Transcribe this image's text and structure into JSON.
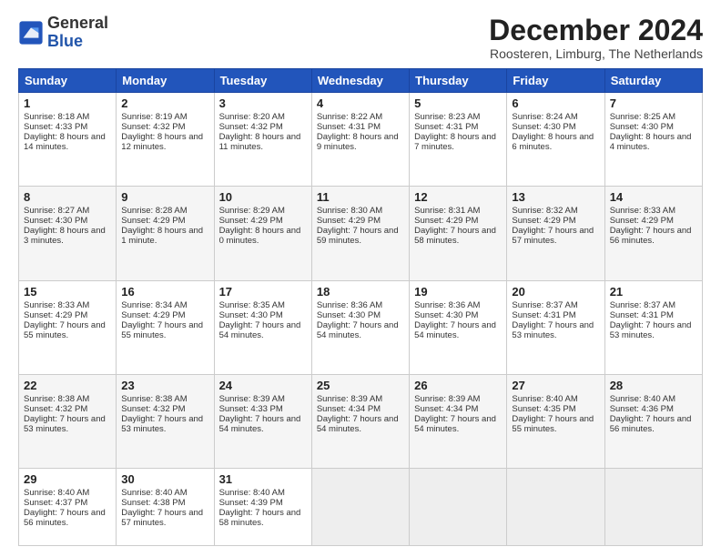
{
  "logo": {
    "general": "General",
    "blue": "Blue"
  },
  "title": "December 2024",
  "subtitle": "Roosteren, Limburg, The Netherlands",
  "weekdays": [
    "Sunday",
    "Monday",
    "Tuesday",
    "Wednesday",
    "Thursday",
    "Friday",
    "Saturday"
  ],
  "weeks": [
    [
      {
        "num": "1",
        "sunrise": "8:18 AM",
        "sunset": "4:33 PM",
        "daylight": "8 hours and 14 minutes"
      },
      {
        "num": "2",
        "sunrise": "8:19 AM",
        "sunset": "4:32 PM",
        "daylight": "8 hours and 12 minutes"
      },
      {
        "num": "3",
        "sunrise": "8:20 AM",
        "sunset": "4:32 PM",
        "daylight": "8 hours and 11 minutes"
      },
      {
        "num": "4",
        "sunrise": "8:22 AM",
        "sunset": "4:31 PM",
        "daylight": "8 hours and 9 minutes"
      },
      {
        "num": "5",
        "sunrise": "8:23 AM",
        "sunset": "4:31 PM",
        "daylight": "8 hours and 7 minutes"
      },
      {
        "num": "6",
        "sunrise": "8:24 AM",
        "sunset": "4:30 PM",
        "daylight": "8 hours and 6 minutes"
      },
      {
        "num": "7",
        "sunrise": "8:25 AM",
        "sunset": "4:30 PM",
        "daylight": "8 hours and 4 minutes"
      }
    ],
    [
      {
        "num": "8",
        "sunrise": "8:27 AM",
        "sunset": "4:30 PM",
        "daylight": "8 hours and 3 minutes"
      },
      {
        "num": "9",
        "sunrise": "8:28 AM",
        "sunset": "4:29 PM",
        "daylight": "8 hours and 1 minute"
      },
      {
        "num": "10",
        "sunrise": "8:29 AM",
        "sunset": "4:29 PM",
        "daylight": "8 hours and 0 minutes"
      },
      {
        "num": "11",
        "sunrise": "8:30 AM",
        "sunset": "4:29 PM",
        "daylight": "7 hours and 59 minutes"
      },
      {
        "num": "12",
        "sunrise": "8:31 AM",
        "sunset": "4:29 PM",
        "daylight": "7 hours and 58 minutes"
      },
      {
        "num": "13",
        "sunrise": "8:32 AM",
        "sunset": "4:29 PM",
        "daylight": "7 hours and 57 minutes"
      },
      {
        "num": "14",
        "sunrise": "8:33 AM",
        "sunset": "4:29 PM",
        "daylight": "7 hours and 56 minutes"
      }
    ],
    [
      {
        "num": "15",
        "sunrise": "8:33 AM",
        "sunset": "4:29 PM",
        "daylight": "7 hours and 55 minutes"
      },
      {
        "num": "16",
        "sunrise": "8:34 AM",
        "sunset": "4:29 PM",
        "daylight": "7 hours and 55 minutes"
      },
      {
        "num": "17",
        "sunrise": "8:35 AM",
        "sunset": "4:30 PM",
        "daylight": "7 hours and 54 minutes"
      },
      {
        "num": "18",
        "sunrise": "8:36 AM",
        "sunset": "4:30 PM",
        "daylight": "7 hours and 54 minutes"
      },
      {
        "num": "19",
        "sunrise": "8:36 AM",
        "sunset": "4:30 PM",
        "daylight": "7 hours and 54 minutes"
      },
      {
        "num": "20",
        "sunrise": "8:37 AM",
        "sunset": "4:31 PM",
        "daylight": "7 hours and 53 minutes"
      },
      {
        "num": "21",
        "sunrise": "8:37 AM",
        "sunset": "4:31 PM",
        "daylight": "7 hours and 53 minutes"
      }
    ],
    [
      {
        "num": "22",
        "sunrise": "8:38 AM",
        "sunset": "4:32 PM",
        "daylight": "7 hours and 53 minutes"
      },
      {
        "num": "23",
        "sunrise": "8:38 AM",
        "sunset": "4:32 PM",
        "daylight": "7 hours and 53 minutes"
      },
      {
        "num": "24",
        "sunrise": "8:39 AM",
        "sunset": "4:33 PM",
        "daylight": "7 hours and 54 minutes"
      },
      {
        "num": "25",
        "sunrise": "8:39 AM",
        "sunset": "4:34 PM",
        "daylight": "7 hours and 54 minutes"
      },
      {
        "num": "26",
        "sunrise": "8:39 AM",
        "sunset": "4:34 PM",
        "daylight": "7 hours and 54 minutes"
      },
      {
        "num": "27",
        "sunrise": "8:40 AM",
        "sunset": "4:35 PM",
        "daylight": "7 hours and 55 minutes"
      },
      {
        "num": "28",
        "sunrise": "8:40 AM",
        "sunset": "4:36 PM",
        "daylight": "7 hours and 56 minutes"
      }
    ],
    [
      {
        "num": "29",
        "sunrise": "8:40 AM",
        "sunset": "4:37 PM",
        "daylight": "7 hours and 56 minutes"
      },
      {
        "num": "30",
        "sunrise": "8:40 AM",
        "sunset": "4:38 PM",
        "daylight": "7 hours and 57 minutes"
      },
      {
        "num": "31",
        "sunrise": "8:40 AM",
        "sunset": "4:39 PM",
        "daylight": "7 hours and 58 minutes"
      },
      null,
      null,
      null,
      null
    ]
  ]
}
